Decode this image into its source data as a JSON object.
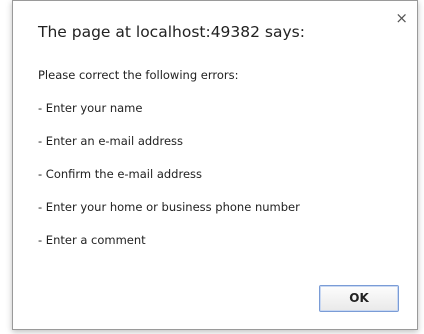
{
  "dialog": {
    "title": "The page at localhost:49382 says:",
    "close_glyph": "×",
    "close_icon": "close-icon",
    "message_lines": [
      "Please correct the following errors:",
      "- Enter your name",
      "- Enter an e-mail address",
      "- Confirm the e-mail address",
      "- Enter your home or business phone number",
      "- Enter a comment"
    ],
    "ok_label": "OK"
  }
}
